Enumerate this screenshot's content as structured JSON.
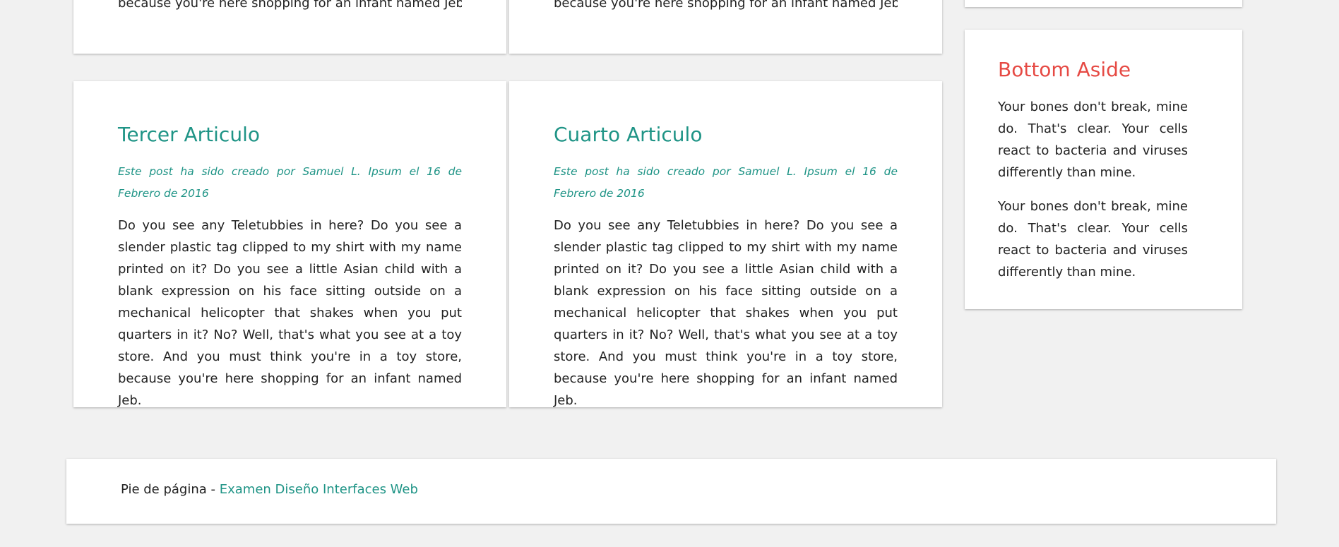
{
  "top_articles": [
    {
      "body_tail": "because you're here shopping for an infant named Jeb."
    },
    {
      "body_tail": "because you're here shopping for an infant named Jeb."
    }
  ],
  "articles": [
    {
      "title": "Tercer Articulo",
      "meta": "Este post ha sido creado por Samuel L. Ipsum el 16 de Febrero de 2016",
      "body": "Do you see any Teletubbies in here? Do you see a slender plastic tag clipped to my shirt with my name printed on it? Do you see a little Asian child with a blank expression on his face sitting outside on a mechanical helicopter that shakes when you put quarters in it? No? Well, that's what you see at a toy store. And you must think you're in a toy store, because you're here shopping for an infant named Jeb."
    },
    {
      "title": "Cuarto Articulo",
      "meta": "Este post ha sido creado por Samuel L. Ipsum el 16 de Febrero de 2016",
      "body": "Do you see any Teletubbies in here? Do you see a slender plastic tag clipped to my shirt with my name printed on it? Do you see a little Asian child with a blank expression on his face sitting outside on a mechanical helicopter that shakes when you put quarters in it? No? Well, that's what you see at a toy store. And you must think you're in a toy store, because you're here shopping for an infant named Jeb."
    }
  ],
  "aside": {
    "title": "Bottom Aside",
    "paragraphs": [
      "Your bones don't break, mine do. That's clear. Your cells react to bacteria and viruses differently than mine.",
      "Your bones don't break, mine do. That's clear. Your cells react to bacteria and viruses differently than mine."
    ]
  },
  "footer": {
    "prefix": "Pie de página - ",
    "link": "Examen Diseño Interfaces Web"
  },
  "colors": {
    "accent": "#1f9486",
    "aside_title": "#e64a44",
    "background": "#f1f1f1"
  }
}
